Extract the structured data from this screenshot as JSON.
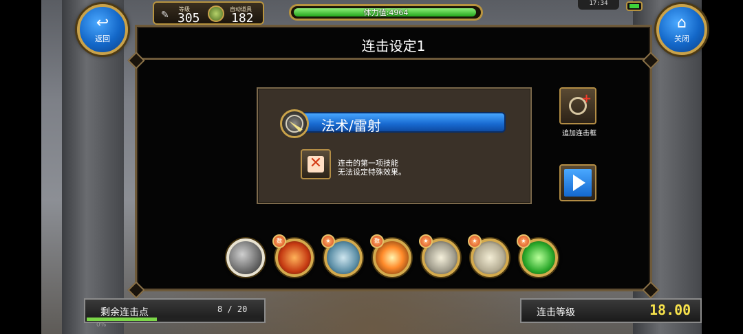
{
  "hud": {
    "level_label": "等级",
    "level": "305",
    "auto_item_label": "自动道具",
    "auto_item_count": "182",
    "stamina_text": "体力值:4964",
    "stamina_fill": 0.99,
    "clock": "17:34",
    "xp_percent_label": "0%"
  },
  "buttons": {
    "back_label": "返回",
    "close_label": "关闭"
  },
  "dialog": {
    "title": "连击设定1",
    "selected_skill": "法术/雷射",
    "note_line1": "连击的第一项技能",
    "note_line2": "无法设定特殊效果。",
    "add_box_label": "追加连击框"
  },
  "skills": [
    {
      "icon": "laser-skill-icon",
      "selected": true,
      "badge": ""
    },
    {
      "icon": "fire-cat-skill-icon",
      "selected": false,
      "badge": "数"
    },
    {
      "icon": "figure-circle-skill-icon",
      "selected": false,
      "badge": "★"
    },
    {
      "icon": "burst-skill-icon",
      "selected": false,
      "badge": "数"
    },
    {
      "icon": "beam-skill-icon",
      "selected": false,
      "badge": "★"
    },
    {
      "icon": "cage-skill-icon",
      "selected": false,
      "badge": "★"
    },
    {
      "icon": "green-figure-skill-icon",
      "selected": false,
      "badge": "★"
    }
  ],
  "bottom": {
    "remaining_label": "剩余连击点",
    "remaining_value": "8 / 20",
    "combo_level_label": "连击等级",
    "combo_level_value": "18.00"
  },
  "colors": {
    "gold_border": "#c9a24a",
    "blue_accent": "#1869d0",
    "level_yellow": "#f7e24b"
  }
}
